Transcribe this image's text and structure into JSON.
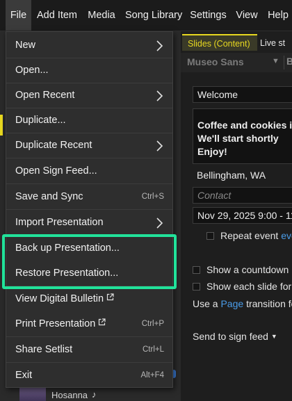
{
  "menubar": {
    "items": [
      {
        "label": "File"
      },
      {
        "label": "Add Item"
      },
      {
        "label": "Media"
      },
      {
        "label": "Song Library"
      },
      {
        "label": "Settings"
      },
      {
        "label": "View"
      },
      {
        "label": "Help"
      }
    ]
  },
  "file_menu": {
    "items": [
      {
        "label": "New",
        "submenu": true
      },
      {
        "label": "Open..."
      },
      {
        "label": "Open Recent",
        "submenu": true
      },
      {
        "label": "Duplicate..."
      },
      {
        "label": "Duplicate Recent",
        "submenu": true
      },
      {
        "label": "Open Sign Feed..."
      },
      {
        "label": "Save and Sync",
        "shortcut": "Ctrl+S"
      },
      {
        "label": "Import Presentation",
        "submenu": true
      },
      {
        "label": "Back up Presentation..."
      },
      {
        "label": "Restore Presentation..."
      },
      {
        "label": "View Digital Bulletin",
        "external": true
      },
      {
        "label": "Print Presentation",
        "external": true,
        "shortcut": "Ctrl+P"
      },
      {
        "label": "Share Setlist",
        "shortcut": "Ctrl+L"
      },
      {
        "label": "Exit",
        "shortcut": "Alt+F4"
      }
    ]
  },
  "tabs": {
    "slides": "Slides (Content)",
    "live": "Live st"
  },
  "font": {
    "name": "Museo Sans",
    "bold_label": "B"
  },
  "editor": {
    "title_value": "Welcome",
    "message_value": "Coffee and cookies in\nWe'll start shortly\nEnjoy!",
    "location_value": "Bellingham, WA",
    "contact_placeholder": "Contact",
    "date_value": "Nov 29, 2025 9:00 - 11",
    "repeat_label": "Repeat event",
    "repeat_link": "eve",
    "countdown_label": "Show a countdown",
    "each_slide_label": "Show each slide for",
    "transition_prefix": "Use a",
    "transition_link": "Page",
    "transition_suffix": "transition fo",
    "send_label": "Send to sign feed"
  },
  "setlist": {
    "item_label": "Hosanna",
    "item_icon": "music-note-icon"
  },
  "colors": {
    "accent": "#e8d820",
    "highlight": "#21e29a",
    "link": "#4a9ce8"
  }
}
